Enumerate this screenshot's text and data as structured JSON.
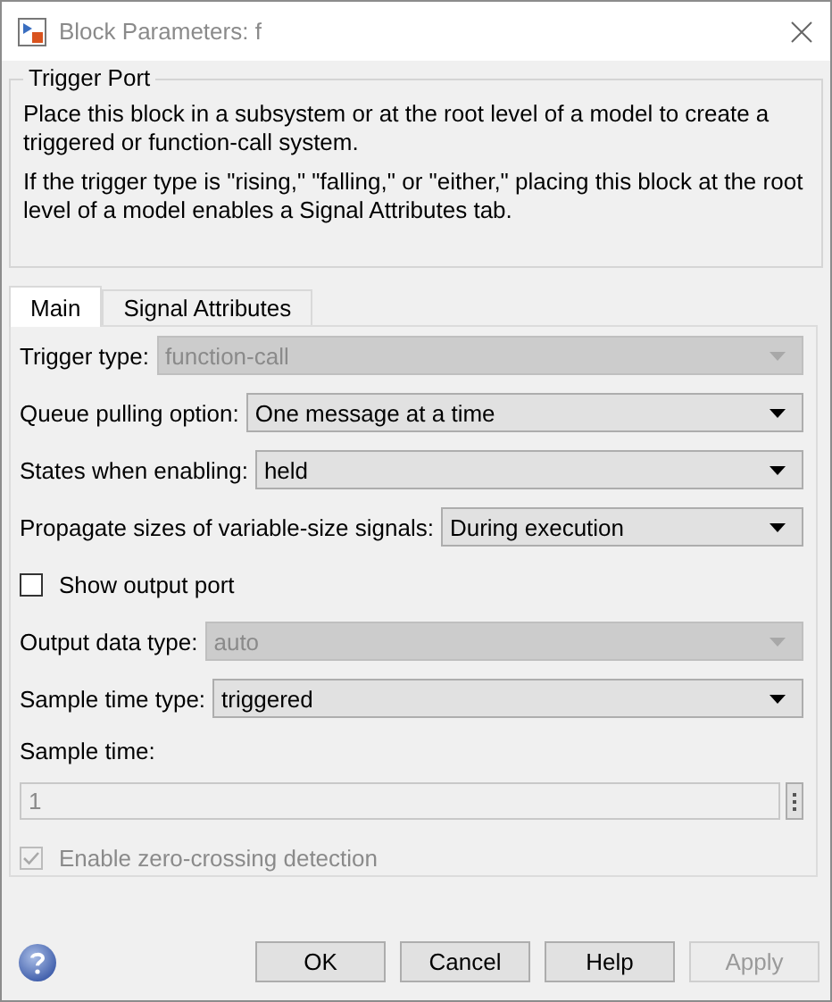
{
  "window": {
    "title": "Block Parameters: f"
  },
  "group": {
    "title": "Trigger Port",
    "paragraphs": [
      "Place this block in a subsystem or at the root level of a model to create a triggered or function-call system.",
      "If the trigger type is \"rising,\" \"falling,\" or \"either,\" placing this block at the root level of a model enables a Signal Attributes tab."
    ]
  },
  "tabs": [
    {
      "label": "Main",
      "selected": true
    },
    {
      "label": "Signal Attributes",
      "selected": false
    }
  ],
  "params": [
    {
      "kind": "dropdown",
      "label": "Trigger type:",
      "value": "function-call",
      "disabled": true
    },
    {
      "kind": "dropdown",
      "label": "Queue pulling option:",
      "value": "One message at a time",
      "disabled": false
    },
    {
      "kind": "dropdown",
      "label": "States when enabling:",
      "value": "held",
      "disabled": false
    },
    {
      "kind": "dropdown",
      "label": "Propagate sizes of variable-size signals:",
      "value": "During execution",
      "disabled": false
    },
    {
      "kind": "checkbox",
      "label": "Show output port",
      "checked": false,
      "disabled": false
    },
    {
      "kind": "dropdown",
      "label": "Output data type:",
      "value": "auto",
      "disabled": true
    },
    {
      "kind": "dropdown",
      "label": "Sample time type:",
      "value": "triggered",
      "disabled": false
    },
    {
      "kind": "field",
      "label": "Sample time:",
      "value": "1",
      "disabled": true
    },
    {
      "kind": "checkbox",
      "label": "Enable zero-crossing detection",
      "checked": true,
      "disabled": true
    }
  ],
  "buttons": [
    {
      "label": "OK",
      "disabled": false
    },
    {
      "label": "Cancel",
      "disabled": false
    },
    {
      "label": "Help",
      "disabled": false
    },
    {
      "label": "Apply",
      "disabled": true
    }
  ]
}
